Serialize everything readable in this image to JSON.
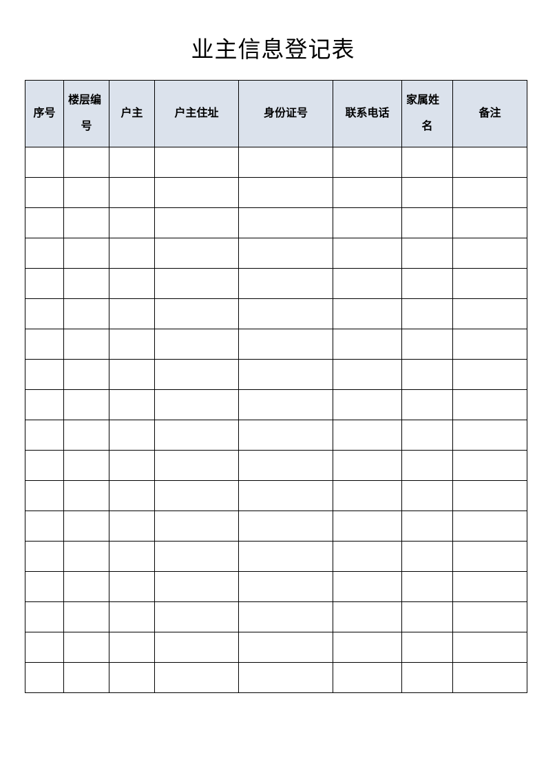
{
  "document": {
    "title": "业主信息登记表",
    "accent_header_bg": "#dbe2ec",
    "border_color": "#000000",
    "text_color": "#000000"
  },
  "table": {
    "columns": [
      {
        "label": "序号",
        "wraps": false,
        "lines": [
          "序号"
        ]
      },
      {
        "label": "楼层编号",
        "wraps": true,
        "lines": [
          "楼层编",
          "号"
        ]
      },
      {
        "label": "户主",
        "wraps": false,
        "lines": [
          "户主"
        ]
      },
      {
        "label": "户主住址",
        "wraps": false,
        "lines": [
          "户主住址"
        ]
      },
      {
        "label": "身份证号",
        "wraps": false,
        "lines": [
          "身份证号"
        ]
      },
      {
        "label": "联系电话",
        "wraps": false,
        "lines": [
          "联系电话"
        ]
      },
      {
        "label": "家属姓名",
        "wraps": true,
        "lines": [
          "家属姓",
          "名"
        ]
      },
      {
        "label": "备注",
        "wraps": false,
        "lines": [
          "备注"
        ]
      }
    ],
    "row_count": 18,
    "rows": [
      [
        "",
        "",
        "",
        "",
        "",
        "",
        "",
        ""
      ],
      [
        "",
        "",
        "",
        "",
        "",
        "",
        "",
        ""
      ],
      [
        "",
        "",
        "",
        "",
        "",
        "",
        "",
        ""
      ],
      [
        "",
        "",
        "",
        "",
        "",
        "",
        "",
        ""
      ],
      [
        "",
        "",
        "",
        "",
        "",
        "",
        "",
        ""
      ],
      [
        "",
        "",
        "",
        "",
        "",
        "",
        "",
        ""
      ],
      [
        "",
        "",
        "",
        "",
        "",
        "",
        "",
        ""
      ],
      [
        "",
        "",
        "",
        "",
        "",
        "",
        "",
        ""
      ],
      [
        "",
        "",
        "",
        "",
        "",
        "",
        "",
        ""
      ],
      [
        "",
        "",
        "",
        "",
        "",
        "",
        "",
        ""
      ],
      [
        "",
        "",
        "",
        "",
        "",
        "",
        "",
        ""
      ],
      [
        "",
        "",
        "",
        "",
        "",
        "",
        "",
        ""
      ],
      [
        "",
        "",
        "",
        "",
        "",
        "",
        "",
        ""
      ],
      [
        "",
        "",
        "",
        "",
        "",
        "",
        "",
        ""
      ],
      [
        "",
        "",
        "",
        "",
        "",
        "",
        "",
        ""
      ],
      [
        "",
        "",
        "",
        "",
        "",
        "",
        "",
        ""
      ],
      [
        "",
        "",
        "",
        "",
        "",
        "",
        "",
        ""
      ],
      [
        "",
        "",
        "",
        "",
        "",
        "",
        "",
        ""
      ]
    ]
  }
}
